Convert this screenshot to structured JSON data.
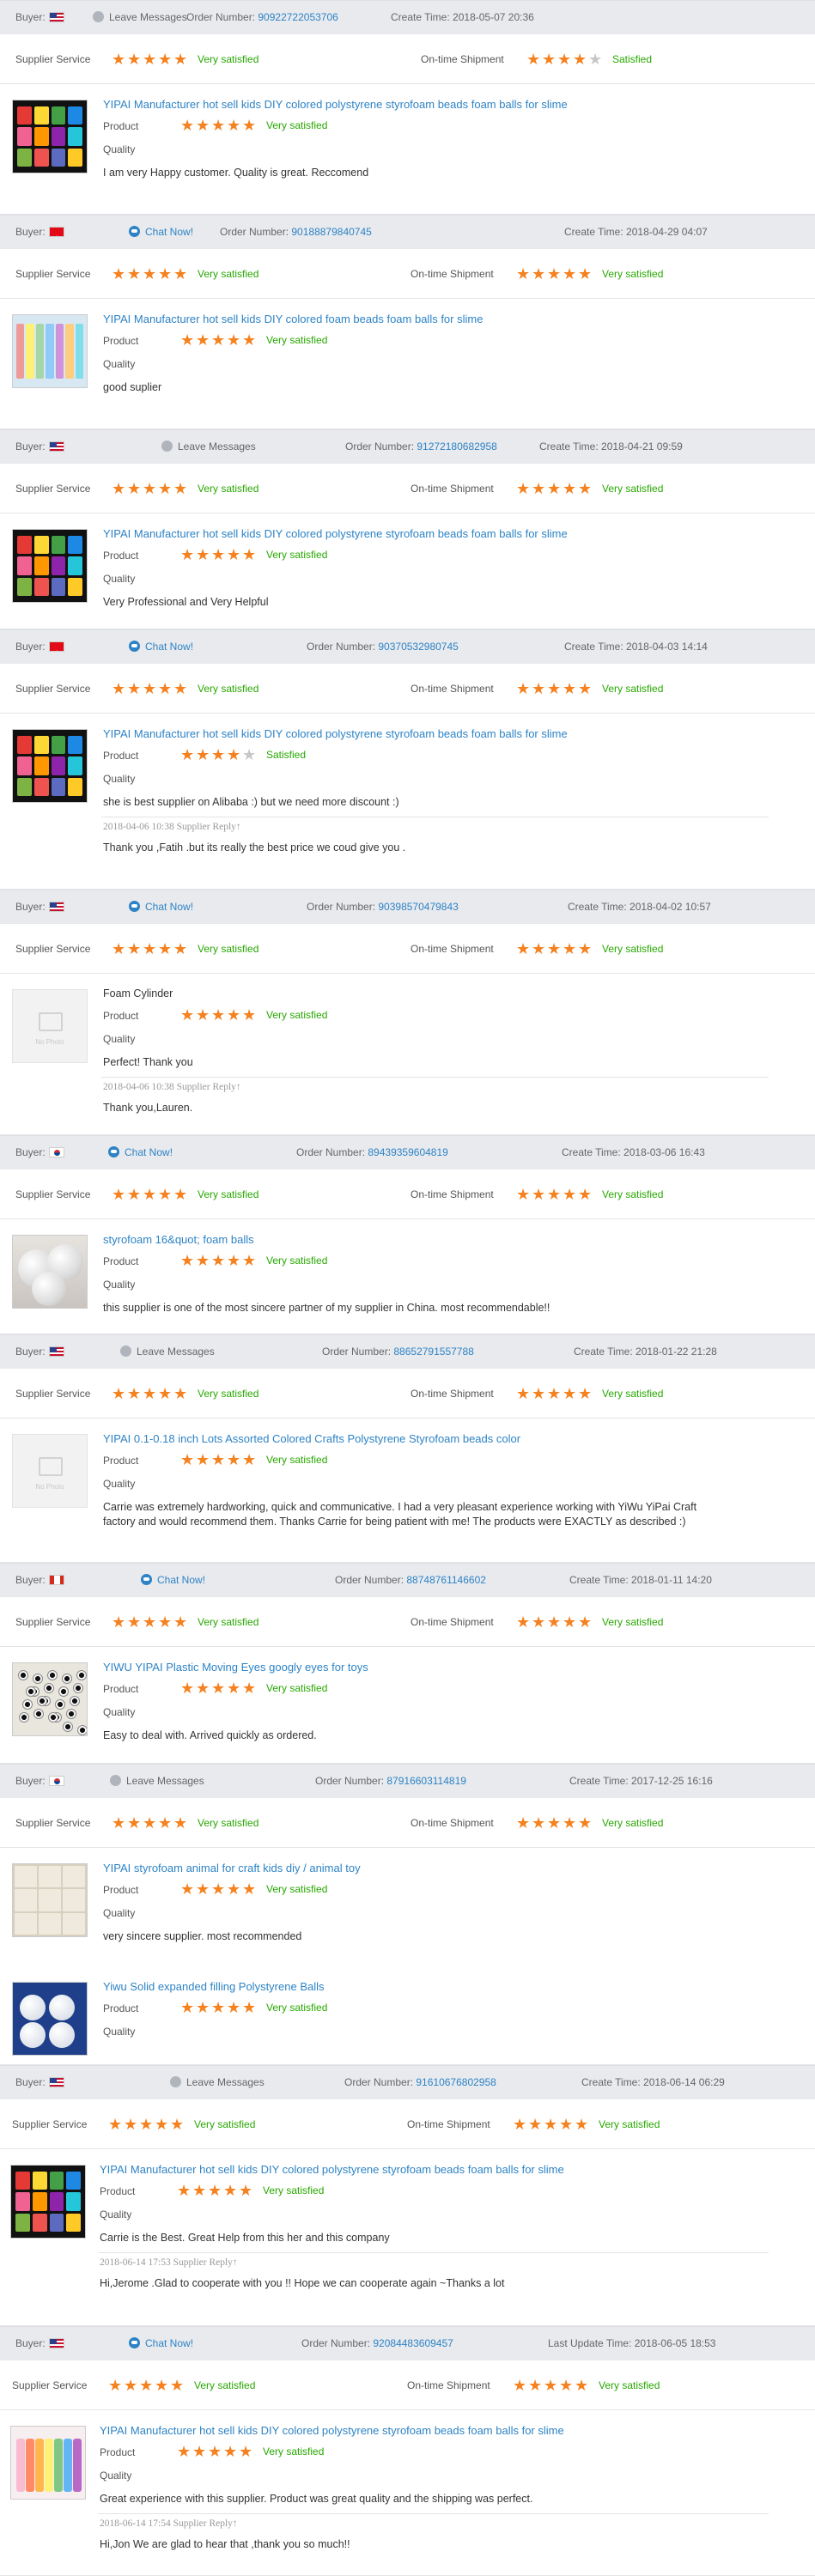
{
  "labels": {
    "buyer": "Buyer:",
    "order_number": "Order Number:",
    "create_time": "Create Time:",
    "last_update_time": "Last Update Time:",
    "supplier_service": "Supplier Service",
    "ontime_shipment": "On-time Shipment",
    "product": "Product",
    "quality": "Quality",
    "supplier_reply": "Supplier Reply↑",
    "no_photo": "No Photo",
    "leave_messages": "Leave Messages",
    "chat_now": "Chat Now!"
  },
  "colors": {
    "accent": "#2d83c5",
    "star": "#f58220",
    "star_off": "#c7c7c7",
    "satisfied": "#27a800",
    "bar_bg": "#e8eaee"
  },
  "reviews": [
    {
      "flag": "US",
      "action": "Leave Messages",
      "order": "90922722053706",
      "time_label": "Create Time:",
      "time": "2018-05-07 20:36",
      "service_stars": 5,
      "service_text": "Very satisfied",
      "ship_stars": 4,
      "ship_text": "Satisfied",
      "items": [
        {
          "title": "YIPAI Manufacturer hot sell kids DIY colored polystyrene styrofoam beads foam balls for slime",
          "thumb": "grid",
          "product_stars": 5,
          "product_text": "Very satisfied",
          "comment": "I am very Happy customer. Quality is great. Reccomend"
        }
      ]
    },
    {
      "flag": "TR",
      "action": "Chat Now!",
      "order": "90188879840745",
      "time_label": "Create Time:",
      "time": "2018-04-29 04:07",
      "service_stars": 5,
      "service_text": "Very satisfied",
      "ship_stars": 5,
      "ship_text": "Very satisfied",
      "items": [
        {
          "title": "YIPAI Manufacturer hot sell kids DIY colored foam beads foam balls for slime",
          "thumb": "strips",
          "product_stars": 5,
          "product_text": "Very satisfied",
          "comment": "good suplier"
        }
      ]
    },
    {
      "flag": "US",
      "action": "Leave Messages",
      "order": "91272180682958",
      "time_label": "Create Time:",
      "time": "2018-04-21 09:59",
      "service_stars": 5,
      "service_text": "Very satisfied",
      "ship_stars": 5,
      "ship_text": "Very satisfied",
      "items": [
        {
          "title": "YIPAI Manufacturer hot sell kids DIY colored polystyrene styrofoam beads foam balls for slime",
          "thumb": "grid",
          "product_stars": 5,
          "product_text": "Very satisfied",
          "comment": "Very Professional and Very Helpful"
        }
      ]
    },
    {
      "flag": "TR",
      "action": "Chat Now!",
      "order": "90370532980745",
      "time_label": "Create Time:",
      "time": "2018-04-03 14:14",
      "service_stars": 5,
      "service_text": "Very satisfied",
      "ship_stars": 5,
      "ship_text": "Very satisfied",
      "items": [
        {
          "title": "YIPAI Manufacturer hot sell kids DIY colored polystyrene styrofoam beads foam balls for slime",
          "thumb": "grid",
          "product_stars": 4,
          "product_text": "Satisfied",
          "comment": "she is best supplier on Alibaba :) but we need more discount :)",
          "reply_date": "2018-04-06 10:38",
          "reply": "Thank you ,Fatih .but its really the best price we coud give you ."
        }
      ]
    },
    {
      "flag": "US",
      "action": "Chat Now!",
      "order": "90398570479843",
      "time_label": "Create Time:",
      "time": "2018-04-02 10:57",
      "service_stars": 5,
      "service_text": "Very satisfied",
      "ship_stars": 5,
      "ship_text": "Very satisfied",
      "items": [
        {
          "title": "Foam Cylinder",
          "plain_title": true,
          "thumb": "nophoto",
          "product_stars": 5,
          "product_text": "Very satisfied",
          "comment": "Perfect! Thank you",
          "reply_date": "2018-04-06 10:38",
          "reply": "Thank you,Lauren."
        }
      ]
    },
    {
      "flag": "KR",
      "action": "Chat Now!",
      "order": "89439359604819",
      "time_label": "Create Time:",
      "time": "2018-03-06 16:43",
      "service_stars": 5,
      "service_text": "Very satisfied",
      "ship_stars": 5,
      "ship_text": "Very satisfied",
      "items": [
        {
          "title": "styrofoam 16&quot; foam balls",
          "thumb": "balls",
          "product_stars": 5,
          "product_text": "Very satisfied",
          "comment": "this supplier is one of the most sincere partner of my supplier in China. most recommendable!!"
        }
      ]
    },
    {
      "flag": "US",
      "action": "Leave Messages",
      "order": "88652791557788",
      "time_label": "Create Time:",
      "time": "2018-01-22 21:28",
      "service_stars": 5,
      "service_text": "Very satisfied",
      "ship_stars": 5,
      "ship_text": "Very satisfied",
      "items": [
        {
          "title": "YIPAI 0.1-0.18 inch Lots Assorted Colored Crafts Polystyrene Styrofoam beads color",
          "thumb": "nophoto",
          "product_stars": 5,
          "product_text": "Very satisfied",
          "comment": "Carrie was extremely hardworking, quick and communicative. I had a very pleasant experience working with YiWu YiPai Craft",
          "comment2": "factory and would recommend them. Thanks Carrie for being patient with me! The products were EXACTLY as described :)"
        }
      ]
    },
    {
      "flag": "CA",
      "action": "Chat Now!",
      "order": "88748761146602",
      "time_label": "Create Time:",
      "time": "2018-01-11 14:20",
      "service_stars": 5,
      "service_text": "Very satisfied",
      "ship_stars": 5,
      "ship_text": "Very satisfied",
      "items": [
        {
          "title": "YIWU YIPAI Plastic Moving Eyes googly eyes for toys",
          "thumb": "eyes",
          "product_stars": 5,
          "product_text": "Very satisfied",
          "comment": "Easy to deal with. Arrived quickly as ordered."
        }
      ]
    },
    {
      "flag": "KR",
      "action": "Leave Messages",
      "order": "87916603114819",
      "time_label": "Create Time:",
      "time": "2017-12-25 16:16",
      "service_stars": 5,
      "service_text": "Very satisfied",
      "ship_stars": 5,
      "ship_text": "Very satisfied",
      "items": [
        {
          "title": "YIPAI styrofoam animal for craft kids diy / animal toy",
          "thumb": "collage",
          "product_stars": 5,
          "product_text": "Very satisfied",
          "comment": "very sincere supplier. most recommended"
        },
        {
          "title": "Yiwu Solid expanded filling Polystyrene Balls",
          "thumb": "bag",
          "product_stars": 5,
          "product_text": "Very satisfied",
          "comment": ""
        }
      ]
    },
    {
      "flag": "US",
      "action": "Leave Messages",
      "order": "91610676802958",
      "time_label": "Create Time:",
      "time": "2018-06-14 06:29",
      "service_stars": 5,
      "service_text": "Very satisfied",
      "ship_stars": 5,
      "ship_text": "Very satisfied",
      "items": [
        {
          "title": "YIPAI Manufacturer hot sell kids DIY colored polystyrene styrofoam beads foam balls for slime",
          "thumb": "grid",
          "product_stars": 5,
          "product_text": "Very satisfied",
          "comment": "Carrie is the Best. Great Help from this her and this company",
          "reply_date": "2018-06-14 17:53",
          "reply": "Hi,Jerome .Glad to cooperate with you !! Hope we can cooperate again ~Thanks a lot"
        }
      ]
    },
    {
      "flag": "US",
      "action": "Chat Now!",
      "order": "92084483609457",
      "time_label": "Last Update Time:",
      "time": "2018-06-05 18:53",
      "service_stars": 5,
      "service_text": "Very satisfied",
      "ship_stars": 5,
      "ship_text": "Very satisfied",
      "items": [
        {
          "title": "YIPAI Manufacturer hot sell kids DIY colored polystyrene styrofoam beads foam balls for slime",
          "thumb": "beads",
          "product_stars": 5,
          "product_text": "Very satisfied",
          "comment": "Great experience with this supplier. Product was great quality and the shipping was perfect.",
          "reply_date": "2018-06-14 17:54",
          "reply": "Hi,Jon We are glad to hear that ,thank you so much!!"
        }
      ]
    }
  ]
}
